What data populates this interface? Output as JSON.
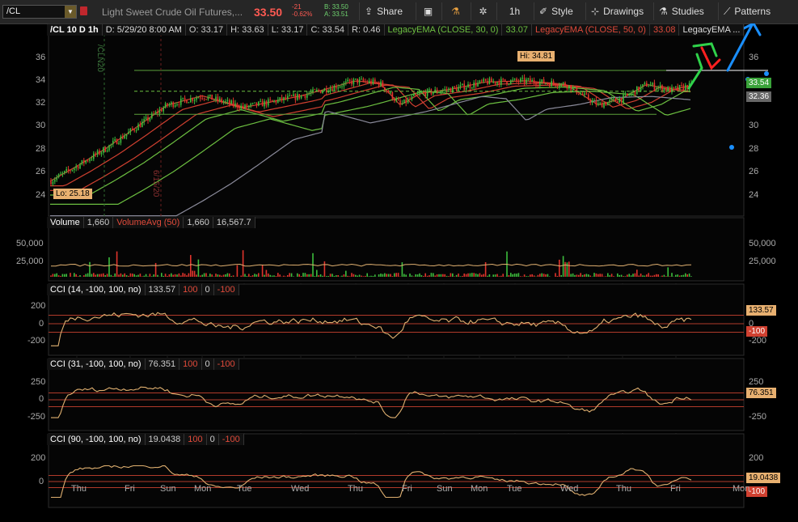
{
  "toolbar": {
    "symbol": "/CL",
    "description": "Light Sweet Crude Oil Futures,...",
    "last": "33.50",
    "change": "-21",
    "change_pct": "-0.62%",
    "bid": "B: 33.50",
    "ask": "A: 33.51",
    "share": "Share",
    "timeframe": "1h",
    "style": "Style",
    "drawings": "Drawings",
    "studies": "Studies",
    "patterns": "Patterns"
  },
  "price_header": {
    "symbol": "/CL 10 D 1h",
    "date": "D: 5/29/20 8:00 AM",
    "open": "O: 33.17",
    "high": "H: 33.63",
    "low": "L: 33.17",
    "close": "C: 33.54",
    "range": "R: 0.46",
    "ema30_label": "LegacyEMA (CLOSE, 30, 0)",
    "ema30_val": "33.07",
    "ema50_label": "LegacyEMA (CLOSE, 50, 0)",
    "ema50_val": "33.08",
    "ema_more": "LegacyEMA ..."
  },
  "price_axis": [
    "36",
    "34",
    "32",
    "30",
    "28",
    "26",
    "24"
  ],
  "price_badges": {
    "current": "33.54",
    "ema": "32.36"
  },
  "hi_label": "Hi: 34.81",
  "lo_label": "Lo: 25.18",
  "vert_labels": {
    "contract": "/CLN20",
    "date": "6/15/20"
  },
  "volume": {
    "header": [
      "Volume",
      "1,660",
      "VolumeAvg (50)",
      "1,660",
      "16,567.7"
    ],
    "axis": [
      "50,000",
      "25,000"
    ],
    "left_axis": [
      "50,000",
      "25,000"
    ]
  },
  "cci14": {
    "header": [
      "CCI (14, -100, 100, no)",
      "133.57",
      "100",
      "0",
      "-100"
    ],
    "axis": [
      "200",
      "0",
      "-200"
    ],
    "badge": "133.57",
    "badge_low": "-100"
  },
  "cci31": {
    "header": [
      "CCI (31, -100, 100, no)",
      "76.351",
      "100",
      "0",
      "-100"
    ],
    "axis": [
      "250",
      "0",
      "-250"
    ],
    "badge": "76.351"
  },
  "cci90": {
    "header": [
      "CCI (90, -100, 100, no)",
      "19.0438",
      "100",
      "0",
      "-100"
    ],
    "axis": [
      "200",
      "0",
      "200"
    ],
    "badge": "19.0438",
    "badge_low": "-100"
  },
  "x_axis": [
    "Thu",
    "Fri",
    "Sun",
    "Mon",
    "Tue",
    "Wed",
    "Thu",
    "Fri",
    "Sun",
    "Mon",
    "Tue",
    "Wed",
    "Thu",
    "Fri",
    "Mon"
  ],
  "colors": {
    "bull": "#3dbd3d",
    "bear": "#e0342c",
    "cci": "#e0b070",
    "ema_green": "#6cbf40",
    "ema_red": "#d04030",
    "ema_gray": "#8a8a9a"
  }
}
